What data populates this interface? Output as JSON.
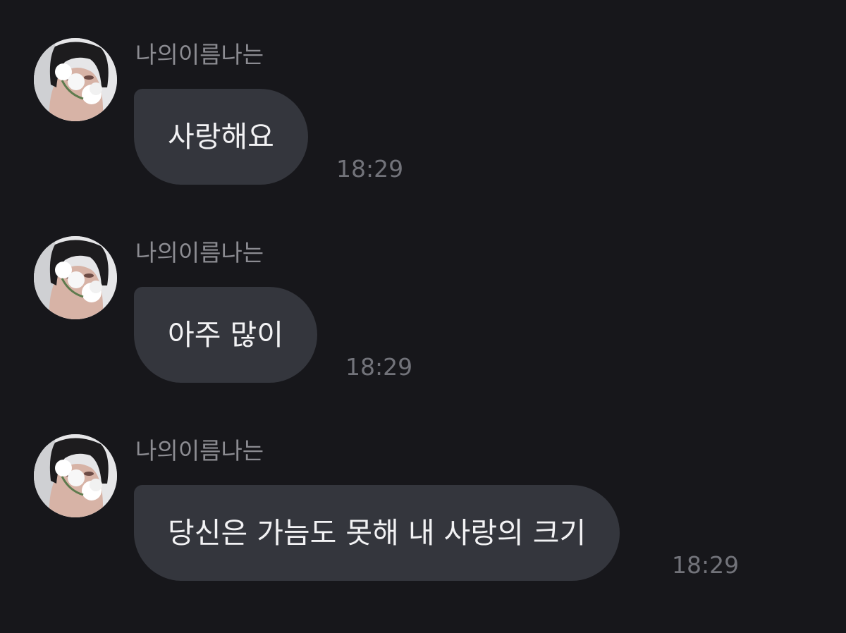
{
  "messages": [
    {
      "sender": "나의이름나는",
      "text": "사랑해요",
      "time": "18:29"
    },
    {
      "sender": "나의이름나는",
      "text": "아주 많이",
      "time": "18:29"
    },
    {
      "sender": "나의이름나는",
      "text": "당신은 가늠도 못해 내 사랑의 크기",
      "time": "18:29"
    }
  ],
  "colors": {
    "background": "#17171b",
    "bubble": "#34363d",
    "message_text": "#f2f2f4",
    "sender_text": "#8c8c92",
    "time_text": "#72737a"
  }
}
